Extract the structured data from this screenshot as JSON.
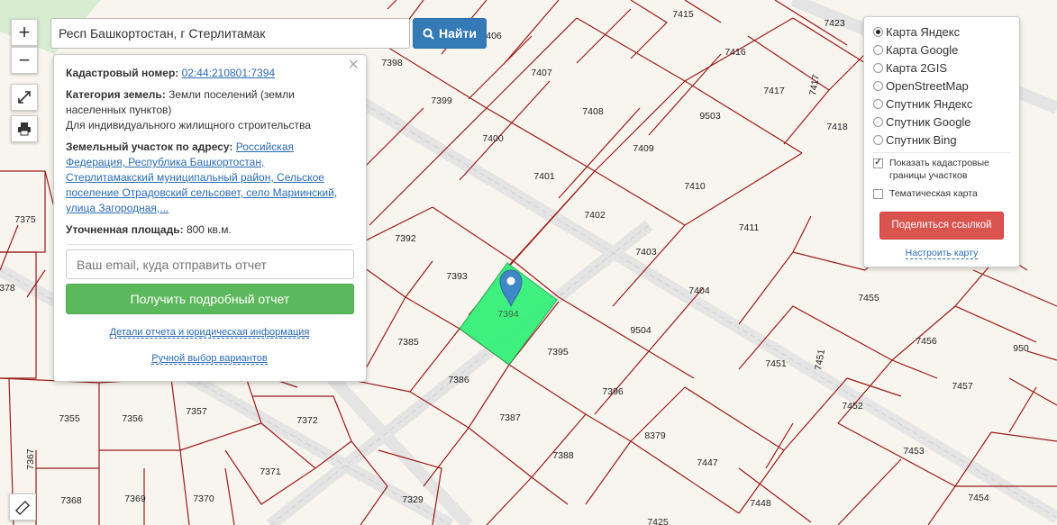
{
  "search": {
    "value": "Респ Башкортостан, г Стерлитамак",
    "button_label": "Найти"
  },
  "zoom": {
    "in_label": "+",
    "out_label": "−"
  },
  "info": {
    "cadastral_label": "Кадастровый номер:",
    "cadastral_number": "02:44:210801:7394",
    "category_label": "Категория земель:",
    "category_value": "Земли поселений (земли населенных пунктов)",
    "usage": "Для индивидуального жилищного строительства",
    "address_label": "Земельный участок по адресу:",
    "address_value": "Российская Федерация, Республика Башкортостан, Стерлитамакский муниципальный район, Сельское поселение Отрадовский сельсовет, село Мариинский, улица Загородная,...",
    "area_label": "Уточненная площадь:",
    "area_value": "800 кв.м.",
    "email_placeholder": "Ваш email, куда отправить отчет",
    "report_button": "Получить подробный отчет",
    "details_link": "Детали отчета и юридическая информация",
    "manual_link": "Ручной выбор вариантов",
    "close": "×"
  },
  "layers": {
    "options": [
      "Карта Яндекс",
      "Карта Google",
      "Карта 2GIS",
      "OpenStreetMap",
      "Спутник Яндекс",
      "Спутник Google",
      "Спутник Bing"
    ],
    "selected": "Карта Яндекс",
    "show_borders": "Показать кадастровые границы участков",
    "thematic": "Тематическая карта",
    "share_button": "Поделиться ссылкой",
    "configure_link": "Настроить карту"
  },
  "parcels": {
    "selected": "7394",
    "labels": [
      "7415",
      "7423",
      "7416",
      "7417",
      "7418",
      "7398",
      "7407",
      "7399",
      "7408",
      "7400",
      "7409",
      "7401",
      "7410",
      "7402",
      "7411",
      "7403",
      "7404",
      "7392",
      "7393",
      "7385",
      "7395",
      "7386",
      "7396",
      "7387",
      "7388",
      "8379",
      "7447",
      "7448",
      "7454",
      "7453",
      "7452",
      "7457",
      "7456",
      "7455",
      "7451",
      "7375",
      "7355",
      "7356",
      "7357",
      "7372",
      "7371",
      "7368",
      "7369",
      "7370",
      "7329",
      "7367"
    ],
    "road_labels": [
      "9503",
      "9504"
    ],
    "partial_labels": [
      "406",
      "378",
      "950",
      "7425"
    ]
  }
}
